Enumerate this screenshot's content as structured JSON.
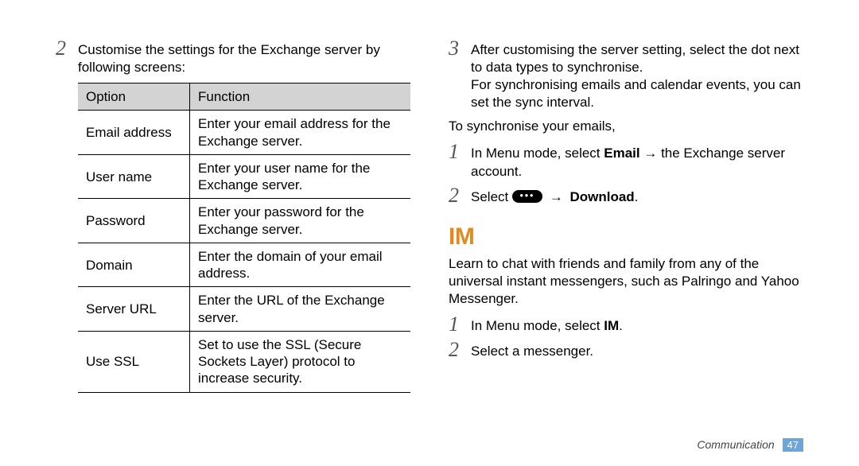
{
  "left": {
    "step2_num": "2",
    "step2_text": "Customise the settings for the Exchange server by following screens:",
    "table": {
      "header_option": "Option",
      "header_function": "Function",
      "rows": {
        "r0_opt": "Email address",
        "r0_fun": "Enter your email address for the Exchange server.",
        "r1_opt": "User name",
        "r1_fun": "Enter your user name for the Exchange server.",
        "r2_opt": "Password",
        "r2_fun": "Enter your password for the Exchange server.",
        "r3_opt": "Domain",
        "r3_fun": "Enter the domain of your email address.",
        "r4_opt": "Server URL",
        "r4_fun": "Enter the URL of the Exchange server.",
        "r5_opt": "Use SSL",
        "r5_fun": "Set to use the SSL (Secure Sockets Layer) protocol to increase security."
      }
    }
  },
  "right": {
    "step3_num": "3",
    "step3_text": "After customising the server setting, select the dot next to data types to synchronise.",
    "step3_sub": "For synchronising emails and calendar events, you can set the sync interval.",
    "sync_intro": "To synchronise your emails,",
    "s1_num": "1",
    "s1_a": "In Menu mode, select ",
    "s1_b_bold": "Email",
    "s1_c": " → the Exchange server account.",
    "s2_num": "2",
    "s2_a": "Select ",
    "s2_arrow": "→",
    "s2_download": "Download",
    "s2_period": ".",
    "im_heading": "IM",
    "im_intro": "Learn to chat with friends and family from any of the universal instant messengers, such as Palringo and Yahoo Messenger.",
    "im1_num": "1",
    "im1_a": "In Menu mode, select ",
    "im1_b_bold": "IM",
    "im1_c": ".",
    "im2_num": "2",
    "im2_text": "Select a messenger."
  },
  "footer": {
    "label": "Communication",
    "page": "47"
  }
}
